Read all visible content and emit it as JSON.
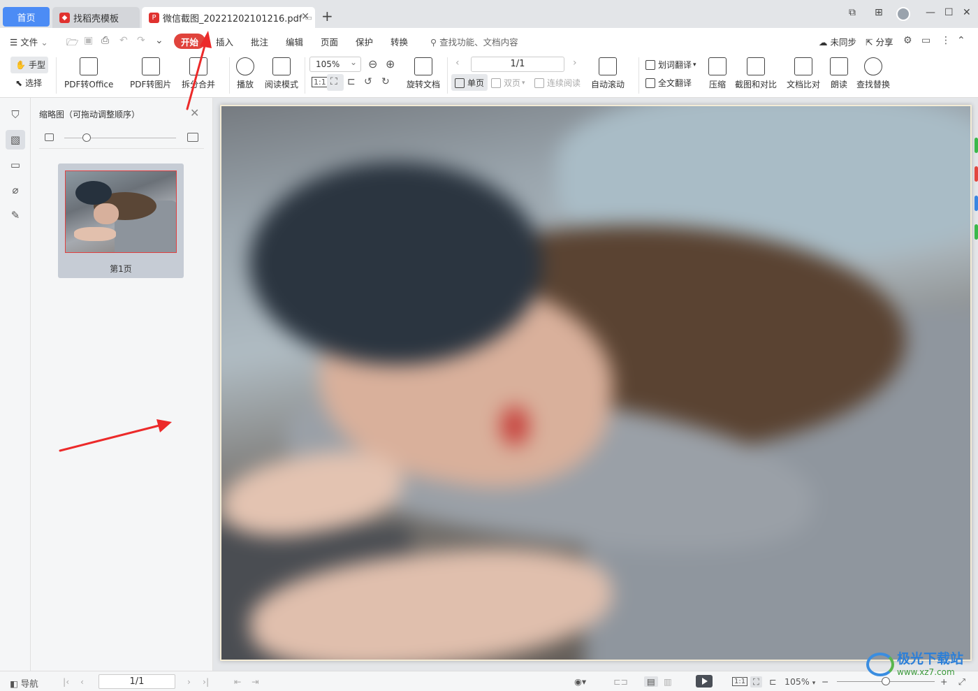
{
  "tabs": {
    "home": "首页",
    "template": "找稻壳模板",
    "document": "微信截图_20221202101216.pdf",
    "add_icon": "plus-icon"
  },
  "menu": {
    "file": "文件",
    "items": [
      "开始",
      "插入",
      "批注",
      "编辑",
      "页面",
      "保护",
      "转换"
    ],
    "search_placeholder": "查找功能、文档内容",
    "sync": "未同步",
    "share": "分享"
  },
  "toolbar": {
    "hand": "手型",
    "select": "选择",
    "pdf_to_office": "PDF转Office",
    "pdf_to_image": "PDF转图片",
    "split_merge": "拆分合并",
    "play": "播放",
    "read_mode": "阅读模式",
    "zoom": "105%",
    "rotate_doc": "旋转文档",
    "page_indicator": "1/1",
    "single_page": "单页",
    "double_page": "双页",
    "continuous": "连续阅读",
    "auto_scroll": "自动滚动",
    "word_translate": "划词翻译",
    "full_translate": "全文翻译",
    "compress": "压缩",
    "screenshot_compare": "截图和对比",
    "doc_compare": "文档比对",
    "read_aloud": "朗读",
    "find_replace": "查找替换"
  },
  "thumbnail_panel": {
    "title": "缩略图（可拖动调整顺序）",
    "zoom_level": 0.2,
    "pages": [
      {
        "label": "第1页"
      }
    ]
  },
  "statusbar": {
    "nav": "导航",
    "page": "1/1",
    "zoom": "105%"
  },
  "watermark": {
    "title": "极光下载站",
    "url": "www.xz7.com"
  },
  "colors": {
    "accent_blue": "#4c8cf5",
    "start_red": "#e0433c",
    "annotation_red": "#ec2a2a"
  }
}
